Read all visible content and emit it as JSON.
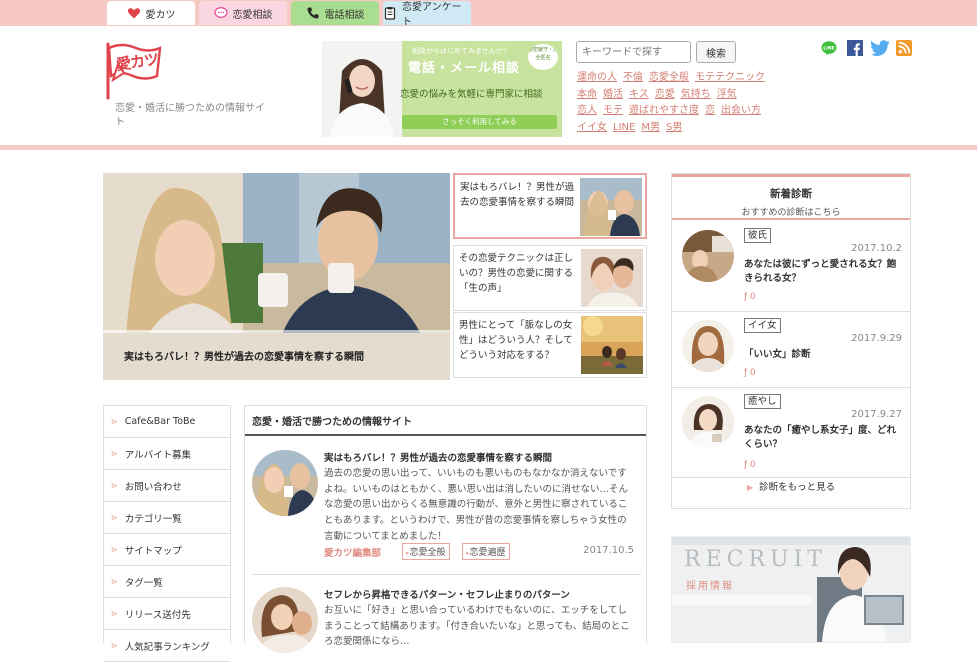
{
  "top_tabs": [
    {
      "label": "愛カツ",
      "icon": "heart-icon"
    },
    {
      "label": "恋愛相談",
      "icon": "chat-bubble-icon"
    },
    {
      "label": "電話相談",
      "icon": "phone-icon"
    },
    {
      "label": "恋愛アンケート",
      "icon": "clipboard-icon"
    }
  ],
  "header": {
    "logo_text": "愛カツ",
    "tagline": "恋愛・婚活に勝つための情報サイト",
    "banner": {
      "badge": "秘密厳守・完全匿名",
      "top_text": "相談からはじめてみませんか？",
      "headline": "電話・メール相談",
      "body": "恋愛の悩みを気軽に専門家に相談",
      "button": "さっそく利用してみる"
    },
    "search": {
      "placeholder": "キーワードで探す",
      "button": "検索"
    },
    "keywords": [
      "運命の人",
      "不倫",
      "恋愛全般",
      "モテテクニック",
      "本命",
      "婚活",
      "キス",
      "恋愛",
      "気持ち",
      "浮気",
      "恋人",
      "モテ",
      "遊ばれやすさ度",
      "恋",
      "出会い方",
      "イイ女",
      "LINE",
      "M男",
      "S男"
    ]
  },
  "featured": {
    "caption": "実はもろバレ！？男性が過去の恋愛事情を察する瞬間",
    "side": [
      {
        "title": "実はもろバレ！？男性が過去の恋愛事情を察する瞬間"
      },
      {
        "title": "その恋愛テクニックは正しいの？男性の恋愛に関する「生の声」"
      },
      {
        "title": "男性にとって「脈なしの女性」はどういう人？そしてどういう対応をする？"
      }
    ]
  },
  "diagnosis": {
    "title": "新着診断",
    "subtitle": "おすすめの診断はこちら",
    "items": [
      {
        "tag": "彼氏",
        "date": "2017.10.2",
        "title": "あなたは彼にずっと愛される女？飽きられる女？",
        "count": "0"
      },
      {
        "tag": "イイ女",
        "date": "2017.9.29",
        "title": "「いい女」診断",
        "count": "0"
      },
      {
        "tag": "癒やし",
        "date": "2017.9.27",
        "title": "あなたの「癒やし系女子」度、どれくらい？",
        "count": "0"
      }
    ],
    "more": "診断をもっと見る"
  },
  "recruit": {
    "title": "RECRUIT",
    "subtitle": "採用情報"
  },
  "menu": [
    "Cafe&Bar ToBe",
    "アルバイト募集",
    "お問い合わせ",
    "カテゴリ一覧",
    "サイトマップ",
    "タグ一覧",
    "リリース送付先",
    "人気記事ランキング"
  ],
  "main": {
    "heading": "恋愛・婚活で勝つための情報サイト",
    "posts": [
      {
        "title": "実はもろバレ！？男性が過去の恋愛事情を察する瞬間",
        "excerpt": "過去の恋愛の思い出って、いいものも悪いものもなかなか消えないですよね。いいものはともかく、悪い思い出は消したいのに消せない…そんな恋愛の思い出からくる無意識の行動が、意外と男性に察されていることもあります。というわけで、男性が昔の恋愛事情を察しちゃう女性の言動についてまとめました！",
        "author": "愛カツ編集部",
        "cats": [
          "恋愛全般",
          "恋愛遍歴"
        ],
        "date": "2017.10.5"
      },
      {
        "title": "セフレから昇格できるパターン・セフレ止まりのパターン",
        "excerpt": "お互いに「好き」と思い合っているわけでもないのに、エッチをしてしまうことって結構あります。「付き合いたいな」と思っても、結局のところ恋愛関係になら…"
      }
    ]
  },
  "colors": {
    "accent": "#e9a79f",
    "topbar": "#f6c9c4",
    "link": "#d47e73"
  }
}
